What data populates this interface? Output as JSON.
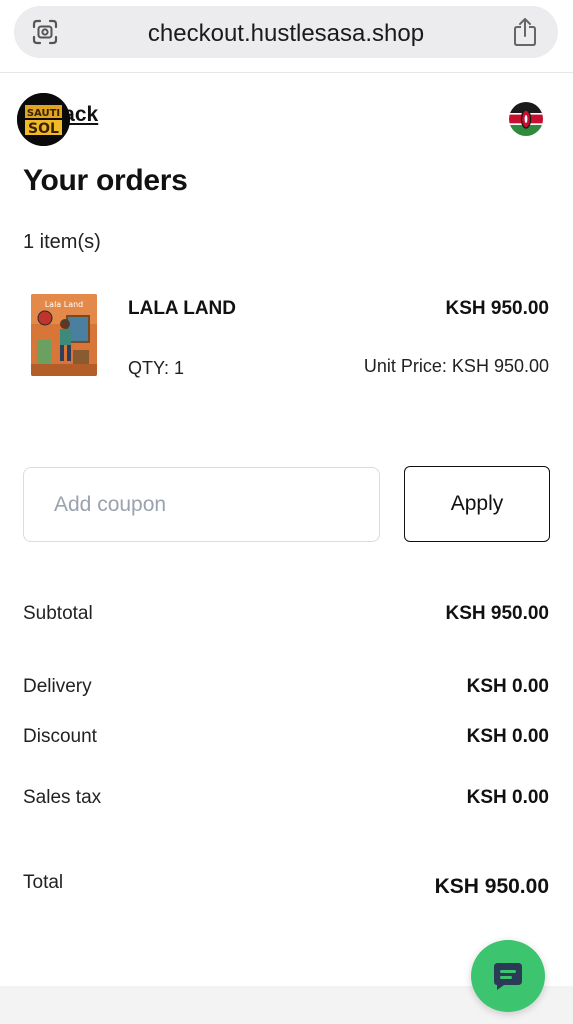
{
  "browser": {
    "url": "checkout.hustlesasa.shop",
    "icons": [
      "scan-icon",
      "share-icon"
    ]
  },
  "header": {
    "logo_text": "SAUTI SOL",
    "back_label": "Back",
    "flag": "kenya-flag"
  },
  "page": {
    "title": "Your orders",
    "item_count": "1 item(s)"
  },
  "order_items": [
    {
      "name": "LALA LAND",
      "price": "KSH 950.00",
      "quantity": "QTY: 1",
      "unit_price": "Unit Price: KSH 950.00",
      "cover_title": "Lala Land"
    }
  ],
  "coupon": {
    "placeholder": "Add coupon",
    "value": "",
    "apply_label": "Apply"
  },
  "summary": {
    "subtotal_label": "Subtotal",
    "subtotal_value": "KSH 950.00",
    "delivery_label": "Delivery",
    "delivery_value": "KSH 0.00",
    "discount_label": "Discount",
    "discount_value": "KSH 0.00",
    "tax_label": "Sales tax",
    "tax_value": "KSH 0.00",
    "total_label": "Total",
    "total_value": "KSH 950.00"
  },
  "chat": {
    "icon": "chat-icon",
    "color": "#3cc46f"
  },
  "colors": {
    "text": "#111111",
    "muted_placeholder": "#9aa2ad",
    "border": "#d9dce0",
    "chat_green": "#3cc46f"
  }
}
